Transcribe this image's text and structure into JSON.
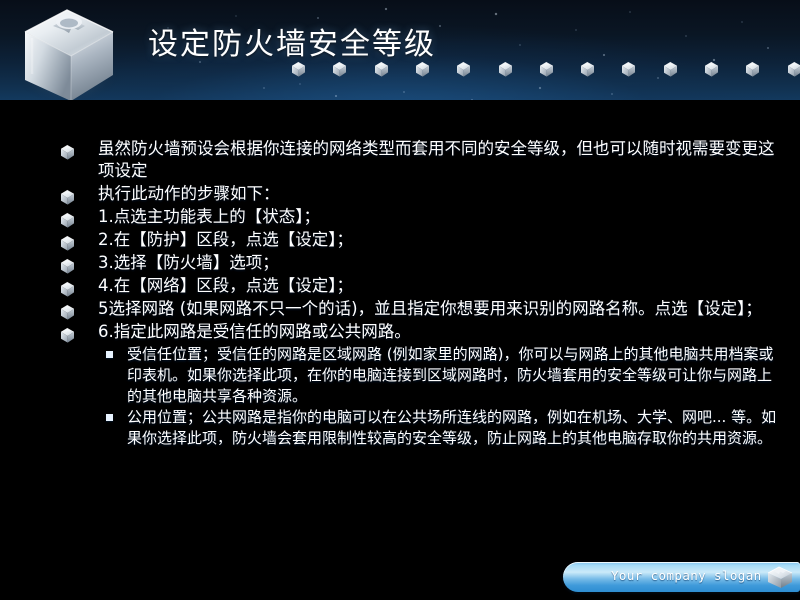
{
  "slide": {
    "title": "设定防火墙安全等级",
    "logo_icon": "metallic-cube-logo-icon"
  },
  "header": {
    "cube_glyph_icon": "mini-cube-icon",
    "cube_glyph_count": 13
  },
  "content": {
    "bullets": [
      {
        "icon": "cube-bullet-icon",
        "text": "虽然防火墙预设会根据你连接的网络类型而套用不同的安全等级，但也可以随时视需要变更这项设定"
      },
      {
        "icon": "cube-bullet-icon",
        "text": "执行此动作的步骤如下："
      },
      {
        "icon": "cube-bullet-icon",
        "text": "1.点选主功能表上的【状态】；"
      },
      {
        "icon": "cube-bullet-icon",
        "text": "2.在【防护】区段，点选【设定】；"
      },
      {
        "icon": "cube-bullet-icon",
        "text": "3.选择【防火墙】选项；"
      },
      {
        "icon": "cube-bullet-icon",
        "text": "4.在【网络】区段，点选【设定】；"
      },
      {
        "icon": "cube-bullet-icon",
        "text": "5选择网路 (如果网路不只一个的话)，並且指定你想要用来识别的网路名称。点选【设定】；"
      },
      {
        "icon": "cube-bullet-icon",
        "text": "6.指定此网路是受信任的网路或公共网路。"
      }
    ],
    "sub_bullets": [
      {
        "icon": "square-bullet-icon",
        "text": "受信任位置；受信任的网路是区域网路 (例如家里的网路)，你可以与网路上的其他电脑共用档案或印表机。如果你选择此项，在你的电脑连接到区域网路时，防火墙套用的安全等级可让你与网路上的其他电脑共享各种资源。"
      },
      {
        "icon": "square-bullet-icon",
        "text": "公用位置；公共网路是指你的电脑可以在公共场所连线的网路，例如在机场、大学、网吧... 等。如果你选择此项，防火墙会套用限制性较高的安全等级，防止网路上的其他电脑存取你的共用资源。"
      }
    ]
  },
  "footer": {
    "slogan": "Your company  slogan",
    "logo_icon": "company-cube-logo-icon"
  },
  "colors": {
    "header_dark": "#070e18",
    "header_mid": "#13395e",
    "body_blue_top": "#0d5a9e",
    "body_blue_bottom": "#029bfa",
    "text": "#ffffff",
    "footer_light": "#cbeaf9",
    "footer_dark": "#2e8ed2"
  }
}
